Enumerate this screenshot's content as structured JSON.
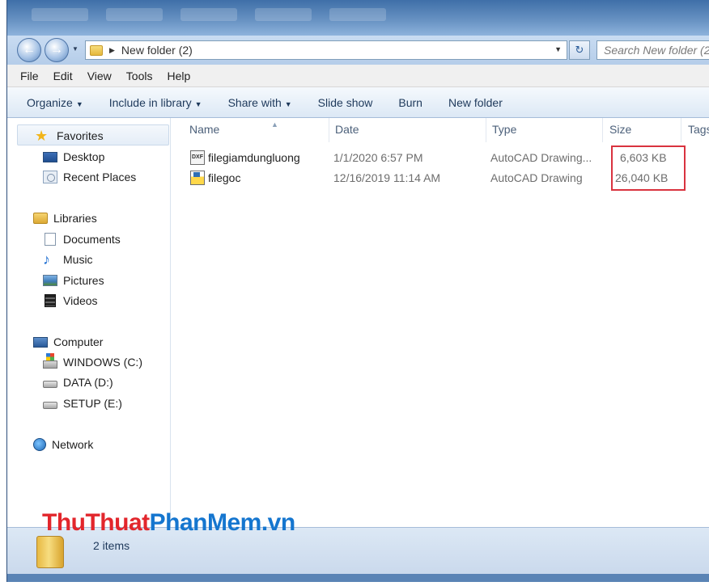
{
  "address_bar": {
    "path_segment": "New folder (2)",
    "search_placeholder": "Search New folder (2)"
  },
  "menu": [
    "File",
    "Edit",
    "View",
    "Tools",
    "Help"
  ],
  "toolbar": {
    "organize": "Organize",
    "include_in_library": "Include in library",
    "share_with": "Share with",
    "slide_show": "Slide show",
    "burn": "Burn",
    "new_folder": "New folder"
  },
  "nav_pane": {
    "favorites": "Favorites",
    "desktop": "Desktop",
    "recent_places": "Recent Places",
    "libraries": "Libraries",
    "documents": "Documents",
    "music": "Music",
    "pictures": "Pictures",
    "videos": "Videos",
    "computer": "Computer",
    "drive_c": "WINDOWS (C:)",
    "drive_d": "DATA (D:)",
    "drive_e": "SETUP (E:)",
    "network": "Network"
  },
  "columns": {
    "name": "Name",
    "date": "Date",
    "type": "Type",
    "size": "Size",
    "tags": "Tags"
  },
  "files": [
    {
      "name": "filegiamdungluong",
      "date": "1/1/2020 6:57 PM",
      "type": "AutoCAD Drawing...",
      "size": "6,603 KB",
      "icon": "dxf-file-icon"
    },
    {
      "name": "filegoc",
      "date": "12/16/2019 11:14 AM",
      "type": "AutoCAD Drawing",
      "size": "26,040 KB",
      "icon": "dwg-file-icon"
    }
  ],
  "status": {
    "item_count": "2 items"
  },
  "watermark": {
    "part1": "ThuThuat",
    "part2": "PhanMem",
    "part3": ".vn"
  },
  "colors": {
    "highlight_border": "#d9333f",
    "watermark_red": "#e2262c",
    "watermark_blue": "#1576cf"
  }
}
